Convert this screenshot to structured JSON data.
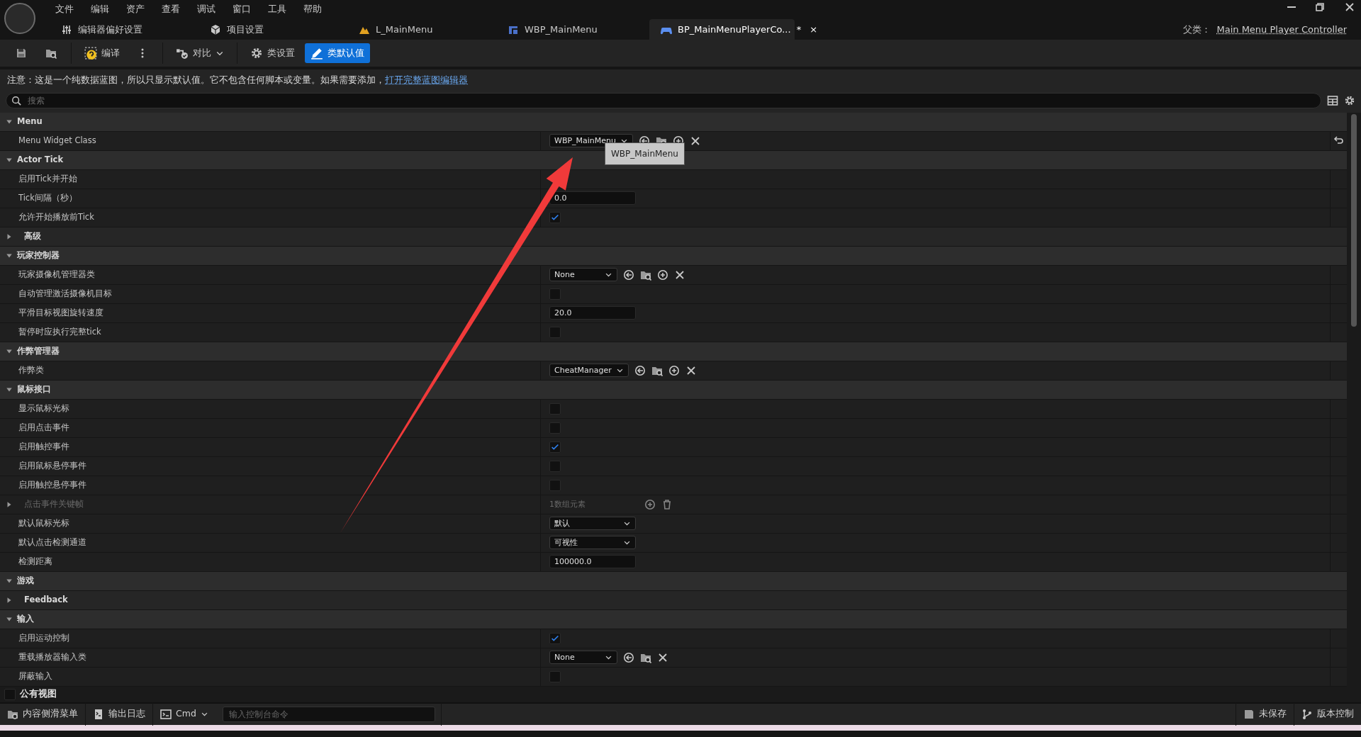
{
  "menu": [
    "文件",
    "编辑",
    "资产",
    "查看",
    "调试",
    "窗口",
    "工具",
    "帮助"
  ],
  "tabs": [
    {
      "label": "编辑器偏好设置",
      "kind": "prefs",
      "selected": false
    },
    {
      "label": "项目设置",
      "kind": "project",
      "selected": false
    },
    {
      "label": "L_MainMenu",
      "kind": "level",
      "selected": false
    },
    {
      "label": "WBP_MainMenu",
      "kind": "widget",
      "selected": false
    },
    {
      "label": "BP_MainMenuPlayerCo...",
      "kind": "blueprint",
      "selected": true,
      "modified": "*",
      "close": "×"
    }
  ],
  "parent_class": {
    "label": "父类：",
    "value": "Main Menu Player Controller"
  },
  "toolbar": [
    {
      "kind": "save"
    },
    {
      "kind": "browse"
    },
    {
      "kind": "compile",
      "label": "编译"
    },
    {
      "kind": "more"
    },
    {
      "kind": "diff",
      "label": "对比"
    },
    {
      "kind": "settings",
      "label": "类设置",
      "selected": false
    },
    {
      "kind": "defaults",
      "label": "类默认值",
      "selected": true
    }
  ],
  "notice": {
    "text": "注意：这是一个纯数据蓝图，所以只显示默认值。它不包含任何脚本或变量。如果需要添加，",
    "link": "打开完整蓝图编辑器"
  },
  "search": {
    "placeholder": "搜索"
  },
  "categories": [
    {
      "label": "Menu",
      "expanded": true,
      "children": [
        {
          "label": "Menu Widget Class",
          "kind": "class",
          "value": "WBP_MainMenu",
          "can_create": true,
          "reset": true,
          "tooltip": "WBP_MainMenu"
        }
      ]
    },
    {
      "label": "Actor Tick",
      "expanded": true,
      "children": [
        {
          "label": "启用Tick并开始",
          "kind": "empty"
        },
        {
          "label": "Tick间隔（秒）",
          "kind": "number",
          "value": "0.0"
        },
        {
          "label": "允许开始播放前Tick",
          "kind": "checkbox",
          "checked": true
        },
        {
          "label": "高级",
          "kind": "group",
          "expanded": false,
          "disabled": false
        }
      ]
    },
    {
      "label": "玩家控制器",
      "expanded": true,
      "children": [
        {
          "label": "玩家摄像机管理器类",
          "kind": "class",
          "value": "None",
          "can_create": true,
          "reset": false
        },
        {
          "label": "自动管理激活摄像机目标",
          "kind": "checkbox",
          "checked": false
        },
        {
          "label": "平滑目标视图旋转速度",
          "kind": "number",
          "value": "20.0"
        },
        {
          "label": "暂停时应执行完整tick",
          "kind": "checkbox",
          "checked": false
        }
      ]
    },
    {
      "label": "作弊管理器",
      "expanded": true,
      "children": [
        {
          "label": "作弊类",
          "kind": "class",
          "value": "CheatManager",
          "can_create": true,
          "reset": false
        }
      ]
    },
    {
      "label": "鼠标接口",
      "expanded": true,
      "children": [
        {
          "label": "显示鼠标光标",
          "kind": "checkbox",
          "checked": false
        },
        {
          "label": "启用点击事件",
          "kind": "checkbox",
          "checked": false
        },
        {
          "label": "启用触控事件",
          "kind": "checkbox",
          "checked": true
        },
        {
          "label": "启用鼠标悬停事件",
          "kind": "checkbox",
          "checked": false
        },
        {
          "label": "启用触控悬停事件",
          "kind": "checkbox",
          "checked": false
        },
        {
          "label": "点击事件关键帧",
          "kind": "array",
          "value": "1数组元素",
          "expanded": false,
          "disabled": true
        },
        {
          "label": "默认鼠标光标",
          "kind": "dropdown",
          "value": "默认"
        },
        {
          "label": "默认点击检测通道",
          "kind": "dropdown",
          "value": "可视性"
        },
        {
          "label": "检测距离",
          "kind": "number",
          "value": "100000.0"
        }
      ]
    },
    {
      "label": "游戏",
      "expanded": true,
      "children": [
        {
          "label": "Feedback",
          "kind": "group",
          "expanded": false,
          "disabled": false
        }
      ]
    },
    {
      "label": "输入",
      "expanded": true,
      "children": [
        {
          "label": "启用运动控制",
          "kind": "checkbox",
          "checked": true
        },
        {
          "label": "重载播放器输入类",
          "kind": "class",
          "value": "None",
          "can_create": false,
          "reset": false
        },
        {
          "label": "屏蔽输入",
          "kind": "checkbox",
          "checked": false
        }
      ]
    }
  ],
  "public_view": {
    "label": "公有视图",
    "checked": false
  },
  "status_bar": {
    "items": [
      {
        "kind": "content",
        "label": "内容侧滑菜单"
      },
      {
        "kind": "log",
        "label": "输出日志"
      },
      {
        "kind": "cmd",
        "label": "Cmd"
      }
    ],
    "console_placeholder": "输入控制台命令",
    "right": [
      {
        "kind": "unsaved",
        "label": "未保存"
      },
      {
        "kind": "vcs",
        "label": "版本控制"
      }
    ]
  }
}
